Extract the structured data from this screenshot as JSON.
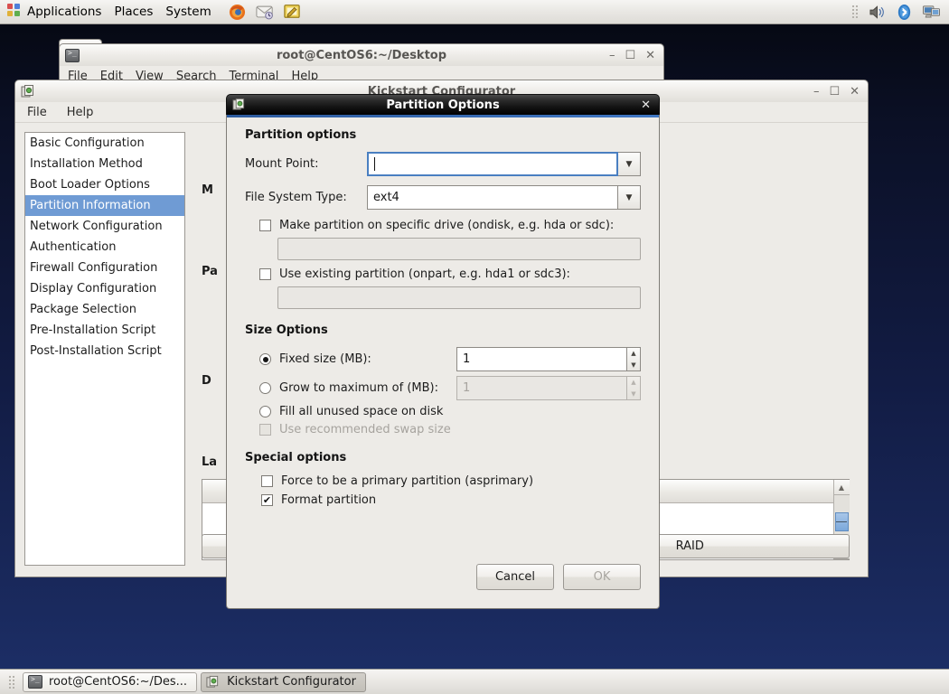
{
  "panel": {
    "menus": [
      "Applications",
      "Places",
      "System"
    ],
    "launchers": [
      "firefox-icon",
      "evolution-mail-icon",
      "text-editor-icon"
    ],
    "tray": [
      "volume-icon",
      "bluetooth-icon",
      "display-icon"
    ]
  },
  "terminal_window": {
    "title": "root@CentOS6:~/Desktop",
    "menus": [
      "File",
      "Edit",
      "View",
      "Search",
      "Terminal",
      "Help"
    ],
    "buttons": {
      "minimize": "–",
      "maximize": "☐",
      "close": "✕"
    }
  },
  "kickstart_window": {
    "title": "Kickstart Configurator",
    "menus": [
      "File",
      "Help"
    ],
    "buttons": {
      "minimize": "–",
      "maximize": "☐",
      "close": "✕"
    },
    "sidebar": {
      "items": [
        {
          "label": "Basic Configuration",
          "selected": false
        },
        {
          "label": "Installation Method",
          "selected": false
        },
        {
          "label": "Boot Loader Options",
          "selected": false
        },
        {
          "label": "Partition Information",
          "selected": true
        },
        {
          "label": "Network Configuration",
          "selected": false
        },
        {
          "label": "Authentication",
          "selected": false
        },
        {
          "label": "Firewall Configuration",
          "selected": false
        },
        {
          "label": "Display Configuration",
          "selected": false
        },
        {
          "label": "Package Selection",
          "selected": false
        },
        {
          "label": "Pre-Installation Script",
          "selected": false
        },
        {
          "label": "Post-Installation Script",
          "selected": false
        }
      ]
    },
    "panel_labels": {
      "master": "M",
      "partition": "Pa",
      "disk": "D",
      "label": "La"
    },
    "action_buttons": {
      "hidden": "",
      "raid": "RAID"
    },
    "selection_color": "#6f9bd4"
  },
  "dialog": {
    "title": "Partition Options",
    "close_label": "✕",
    "sections": {
      "partition_options": {
        "heading": "Partition options",
        "mount_point": {
          "label": "Mount Point:",
          "value": "",
          "focused": true
        },
        "file_system_type": {
          "label": "File System Type:",
          "value": "ext4"
        },
        "ondisk": {
          "label": "Make partition on specific drive (ondisk, e.g. hda or sdc):",
          "checked": false,
          "value": ""
        },
        "onpart": {
          "label": "Use existing partition (onpart, e.g. hda1 or sdc3):",
          "checked": false,
          "value": ""
        }
      },
      "size_options": {
        "heading": "Size Options",
        "fixed_size": {
          "label": "Fixed size (MB):",
          "selected": true,
          "value": "1"
        },
        "grow_to_max": {
          "label": "Grow to maximum of (MB):",
          "selected": false,
          "value": "1",
          "disabled": true
        },
        "fill_all": {
          "label": "Fill all unused space on disk",
          "selected": false
        },
        "recommended_swap": {
          "label": "Use recommended swap size",
          "checked": false,
          "disabled": true
        }
      },
      "special_options": {
        "heading": "Special options",
        "asprimary": {
          "label": "Force to be a primary partition (asprimary)",
          "checked": false
        },
        "format": {
          "label": "Format partition",
          "checked": true
        }
      }
    },
    "footer": {
      "cancel": "Cancel",
      "ok": "OK",
      "ok_disabled": true
    }
  },
  "taskbar": {
    "items": [
      {
        "label": "root@CentOS6:~/Des...",
        "icon": "terminal-icon",
        "active": false
      },
      {
        "label": "Kickstart Configurator",
        "icon": "kickstart-icon",
        "active": true
      }
    ]
  },
  "glyphs": {
    "check": "✔",
    "caret_down": "▼",
    "arrow_up": "▲",
    "arrow_down": "▼"
  }
}
